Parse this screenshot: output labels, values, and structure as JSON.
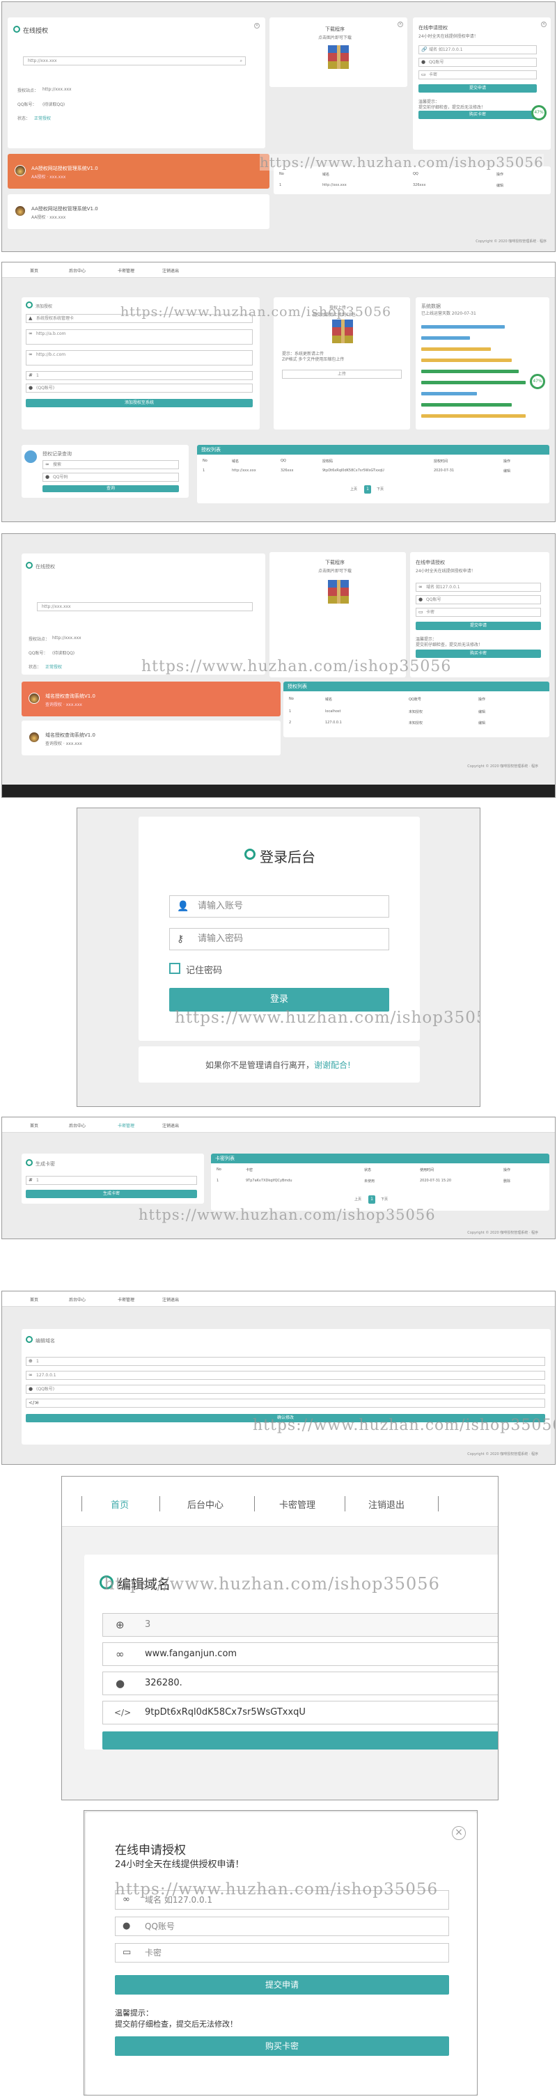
{
  "colors": {
    "teal": "#3ea9a9",
    "orange": "#e8794a",
    "green": "#3aa35a",
    "blue": "#5aa5d8",
    "yellow": "#e6b84a"
  },
  "watermark": {
    "text": "https://www.huzhan.com/ishop35056"
  },
  "nav": {
    "home": "首页",
    "backend": "后台中心",
    "cards": "卡密管理",
    "logout": "注销退出"
  },
  "copyright": {
    "text": "Copyright © 2020 咖啡授权管理系统 · 程序",
    "link": "程序"
  },
  "query": {
    "title": "在线授权",
    "input_value": "http://xxx.xxx",
    "site_label": "授权站点：",
    "site_value": "http://xxx.xxx",
    "qq_label": "QQ账号：",
    "qq_value": "(待读取QQ)",
    "status_label": "状态：",
    "status_value": "正常授权",
    "download_title": "下载程序",
    "download_sub": "点击图片即可下载"
  },
  "apply": {
    "title": "在线申请授权",
    "subtitle": "24小时全天在线提供授权申请！",
    "domain_placeholder": "域名 如127.0.0.1",
    "qq_placeholder": "QQ账号",
    "card_placeholder": "卡密",
    "submit": "提交申请",
    "tip_title": "温馨提示：",
    "tip_text": "提交前仔细检查，提交后无法修改！",
    "buy": "购买卡密",
    "percent": "47%"
  },
  "ad": {
    "orange_title": "AA授权网站授权管理系统V1.0",
    "orange_sub": "AA授权 · xxx.xxx",
    "white_title": "AA授权网站授权管理系统V1.0",
    "white_sub": "AA授权 · xxx.xxx",
    "orange_title_3": "域名授权查询系统V1.0",
    "orange_sub_3": "查询授权 · xxx.xxx",
    "white_title_3": "域名授权查询系统V1.0",
    "white_sub_3": "查询授权 · xxx.xxx"
  },
  "shot2": {
    "add_title": "添加授权",
    "field1": "系统授权系统管理卡",
    "field2": "http://a.b.com",
    "field3": "http://b.c.com",
    "field4": "1",
    "field5": "(QQ账号)",
    "submit": "添加授权至系统",
    "upload_title": "授权上传",
    "upload_sub": "提交付款后上传到CP包",
    "upload_note1": "提示：系统更新请上传",
    "upload_note2": "ZIP格式 多个文件使用压缩包上传",
    "upload_btn": "上传",
    "stats_title": "系统数据",
    "stats_sub": "已上线运营天数 2020-07-31",
    "search_title": "授权记录查询",
    "search_f1": "搜索",
    "search_f2": "QQ号码",
    "search_btn": "查询",
    "list_title": "授权列表",
    "list_cols": [
      "No",
      "域名",
      "QQ",
      "授权码",
      "授权时间",
      "操作"
    ],
    "list_row": [
      "1",
      "http://xxx.xxx",
      "326xxx",
      "9tpDt6xRql0dK58Cx7sr5WsGTxxqU",
      "2020-07-31",
      "编辑"
    ],
    "pager_prev": "上页",
    "pager_cur": "1",
    "pager_next": "下页"
  },
  "shot3": {
    "list_title": "授权列表",
    "cols": [
      "No",
      "域名",
      "QQ账号",
      "操作"
    ],
    "rows": [
      [
        "1",
        "localhost",
        "未知授权",
        "编辑"
      ],
      [
        "2",
        "127.0.0.1",
        "未知授权",
        "编辑"
      ]
    ]
  },
  "login": {
    "title": "登录后台",
    "user_placeholder": "请输入账号",
    "pass_placeholder": "请输入密码",
    "remember": "记住密码",
    "submit": "登录",
    "notice": "如果你不是管理请自行离开，",
    "notice_link": "谢谢配合!"
  },
  "shot5": {
    "gen_title": "生成卡密",
    "gen_field": "1",
    "gen_btn": "生成卡密",
    "list_title": "卡密列表",
    "cols": [
      "No",
      "卡密",
      "状态",
      "使用时间",
      "操作"
    ],
    "row": [
      "1",
      "9Tp7aKv7XDkqlfQCyBmdu",
      "未使用",
      "2020-07-31 15:20",
      "删除"
    ]
  },
  "edit": {
    "title": "编辑域名",
    "id": "3",
    "domain": "www.fanganjun.com",
    "qq": "326280.",
    "code": "9tpDt6xRql0dK58Cx7sr5WsGTxxqU",
    "btn": "确认修改",
    "mini_id": "1",
    "mini_domain": "127.0.0.1",
    "mini_qq": "(QQ账号)",
    "mini_code": "0"
  }
}
